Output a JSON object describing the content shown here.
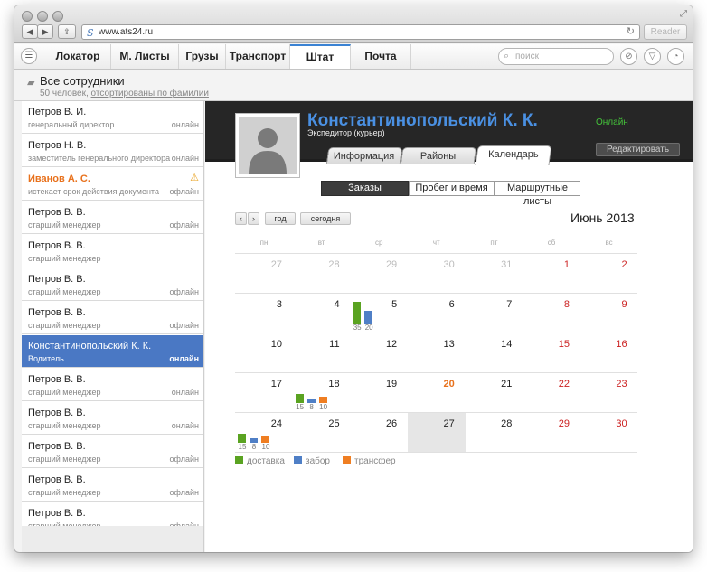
{
  "browser": {
    "url": "www.ats24.ru",
    "reader_label": "Reader",
    "back_glyph": "◀",
    "forward_glyph": "▶",
    "share_glyph": "⇪"
  },
  "nav": {
    "tabs": [
      "Локатор",
      "М. Листы",
      "Грузы",
      "Транспорт",
      "Штат",
      "Почта"
    ],
    "active_tab": "Штат",
    "search_placeholder": "поиск"
  },
  "list": {
    "title": "Все сотрудники",
    "subtitle_prefix": "50 человек, ",
    "subtitle_link": "отсортированы по фамилии",
    "employees": [
      {
        "name": "Петров В. И.",
        "role": "генеральный директор",
        "status": "онлайн"
      },
      {
        "name": "Петров Н. В.",
        "role": "заместитель генерального директора",
        "status": "онлайн"
      },
      {
        "name": "Иванов А. С.",
        "role": "истекает срок действия документа",
        "status": "офлайн"
      },
      {
        "name": "Петров В. В.",
        "role": "старший менеджер",
        "status": "офлайн"
      },
      {
        "name": "Петров В. В.",
        "role": "старший менеджер",
        "status": ""
      },
      {
        "name": "Петров В. В.",
        "role": "старший менеджер",
        "status": "офлайн"
      },
      {
        "name": "Петров В. В.",
        "role": "старший менеджер",
        "status": "офлайн"
      },
      {
        "name": "Константинопольский К. К.",
        "role": "Водитель",
        "status": "онлайн"
      },
      {
        "name": "Петров В. В.",
        "role": "старший менеджер",
        "status": "онлайн"
      },
      {
        "name": "Петров В. В.",
        "role": "старший менеджер",
        "status": "онлайн"
      },
      {
        "name": "Петров В. В.",
        "role": "старший менеджер",
        "status": "офлайн"
      },
      {
        "name": "Петров В. В.",
        "role": "старший менеджер",
        "status": "офлайн"
      },
      {
        "name": "Петров В. В.",
        "role": "старший менеджер",
        "status": "офлайн"
      },
      {
        "name": "Петров В. В.",
        "role": "старший менеджер",
        "status": "офлайн"
      }
    ]
  },
  "profile": {
    "name": "Константинопольский К. К.",
    "role": "Экспедитор (курьер)",
    "status": "Онлайн",
    "edit_label": "Редактировать",
    "tabs": [
      "Информация",
      "Районы",
      "Календарь"
    ],
    "active_tab": "Календарь"
  },
  "calendar": {
    "segments": [
      "Заказы",
      "Пробег и время",
      "Маршрутные листы"
    ],
    "active_segment": "Заказы",
    "year_label": "год",
    "today_label": "сегодня",
    "month_title": "Июнь 2013",
    "weekdays": [
      "пн",
      "вт",
      "ср",
      "чт",
      "пт",
      "сб",
      "вс"
    ],
    "weeks": [
      [
        "27",
        "28",
        "29",
        "30",
        "31",
        "1",
        "2"
      ],
      [
        "3",
        "4",
        "5",
        "6",
        "7",
        "8",
        "9"
      ],
      [
        "10",
        "11",
        "12",
        "13",
        "14",
        "15",
        "16"
      ],
      [
        "17",
        "18",
        "19",
        "20",
        "21",
        "22",
        "23"
      ],
      [
        "24",
        "25",
        "26",
        "27",
        "28",
        "29",
        "30"
      ]
    ],
    "muted_days": [
      "0-0",
      "0-1",
      "0-2",
      "0-3",
      "0-4"
    ],
    "highlight_day": "3-3",
    "today_cell": "4-3",
    "colors": {
      "delivery": "#5aa321",
      "pickup": "#4f7fc6",
      "transfer": "#ef7e22",
      "weekend": "#cc2222"
    },
    "bars": [
      {
        "cell": "1-2",
        "values": [
          35,
          20,
          0
        ]
      },
      {
        "cell": "3-1",
        "values": [
          15,
          8,
          10
        ]
      },
      {
        "cell": "4-0",
        "values": [
          15,
          8,
          10
        ]
      }
    ],
    "legend": [
      "доставка",
      "забор",
      "трансфер"
    ]
  }
}
